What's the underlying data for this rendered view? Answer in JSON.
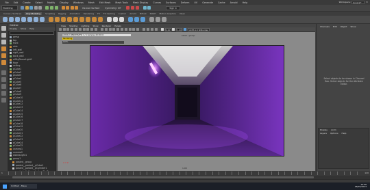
{
  "menubar": {
    "items": [
      "File",
      "Edit",
      "Create",
      "Select",
      "Modify",
      "Display",
      "Windows",
      "Mesh",
      "Edit Mesh",
      "Mesh Tools",
      "Mesh Display",
      "Curves",
      "Surfaces",
      "Deform",
      "UV",
      "Generate",
      "Cache",
      "Arnold",
      "Help"
    ],
    "workspace_label": "Workspace:",
    "workspace_value": "General*"
  },
  "statusline": {
    "mode": "Modeling",
    "object_field": "No Live Surface",
    "symmetry": "Symmetry: Off",
    "sign_in": "Sign In"
  },
  "shelf": {
    "tabs": [
      "Curves / Surfaces",
      "Poly Modeling",
      "Sculpting",
      "Rigging",
      "Animation",
      "Rendering",
      "FX",
      "FX Caching",
      "Custom",
      "Arnold",
      "Bifrost",
      "MASH",
      "Motion Graphics",
      "XGen"
    ],
    "active_tab": "Poly Modeling"
  },
  "outliner": {
    "title": "Outliner",
    "menu": [
      "Display",
      "Show",
      "Help"
    ],
    "search_placeholder": "Search...",
    "items": [
      "persp",
      "top",
      "front",
      "side",
      "left_wall",
      "right_wall",
      "back_wall",
      "aiSkyDomeLight1",
      "floor",
      "ceiling",
      "pCube1",
      "pCube2",
      "pCube3",
      "pCube4",
      "pCube5",
      "pCube6",
      "pCube7",
      "pCube8",
      "pCube9",
      "pCube10",
      "pCube11",
      "pCube12",
      "pCube13",
      "pCube14",
      "pCube15",
      "pCube16",
      "pCube17",
      "pCube18",
      "pCube19",
      "pCube20",
      "pCube21",
      "pCube22",
      "pCube23",
      "pCube24",
      "pCube25",
      "camera1",
      "camera2",
      "aiAreaLight1",
      "group1",
      "pasted__group",
      "pasted__pasted__pCube1",
      "pasted__pasted__pCylinder1",
      "pasted__light_pasted__aiSkyDom",
      "defaultLightSet",
      "defaultObjectSet"
    ]
  },
  "panel": {
    "menu": [
      "View",
      "Shading",
      "Lighting",
      "Show",
      "Renderer",
      "Panels"
    ],
    "gamma_a": "0.00",
    "gamma_b": "1.00",
    "color_space": "ACES 1.0 SDR-video (ACES)",
    "camera_name": "side1 / persp",
    "hud_line": "ARNOLD RENDERVIEW   1 / 1   Samples   00:00:02",
    "hud_status": "Rendering",
    "hud_progress": "100%",
    "frame_label": "1.00",
    "axis_label": "X Y Z"
  },
  "attribute_editor": {
    "tabs": [
      "Channels",
      "Edit",
      "Object",
      "Show"
    ],
    "message": "Select objects to be shown in Channel Box. Select objects for the Attribute Editor.",
    "layers_tabs": [
      "Display",
      "Anim"
    ],
    "layers_menu": [
      "Layers",
      "Options",
      "Help"
    ]
  },
  "timeslider": {
    "start": "1",
    "end": "120",
    "current": "1"
  },
  "taskbar": {
    "item": "Untitled - Maya",
    "time": "14:56",
    "date": "26/05/2023"
  },
  "colors": {
    "purple_wall": "#6a2aa8",
    "purple_bright": "#b050ff",
    "accent_blue": "#4aa3ff",
    "viewport_gray": "#8a8a8a"
  }
}
